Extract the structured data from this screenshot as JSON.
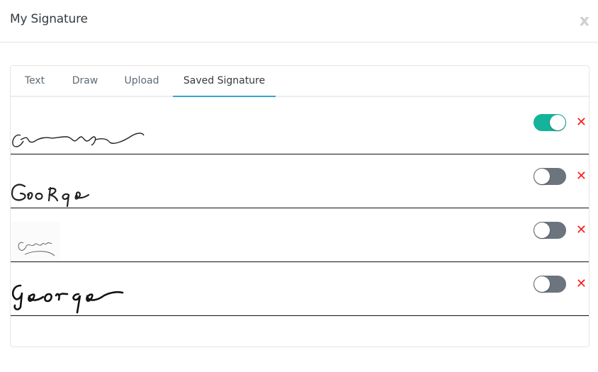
{
  "dialog": {
    "title": "My Signature",
    "close_label": "x"
  },
  "tabs": [
    {
      "label": "Text",
      "active": false
    },
    {
      "label": "Draw",
      "active": false
    },
    {
      "label": "Upload",
      "active": false
    },
    {
      "label": "Saved Signature",
      "active": true
    }
  ],
  "signatures": [
    {
      "name": "George",
      "style": "handwritten-cursive-scrawl",
      "enabled": true,
      "delete_label": "✕"
    },
    {
      "name": "George",
      "style": "handwritten-print",
      "enabled": false,
      "delete_label": "✕"
    },
    {
      "name": "George",
      "style": "uploaded-image-calligraphy",
      "enabled": false,
      "delete_label": "✕"
    },
    {
      "name": "George",
      "style": "brush-script",
      "enabled": false,
      "delete_label": "✕"
    }
  ],
  "colors": {
    "toggle_on": "#13b49a",
    "toggle_off": "#6c757d",
    "delete": "#ff1a1a",
    "active_tab_underline": "#3aa4d0"
  }
}
